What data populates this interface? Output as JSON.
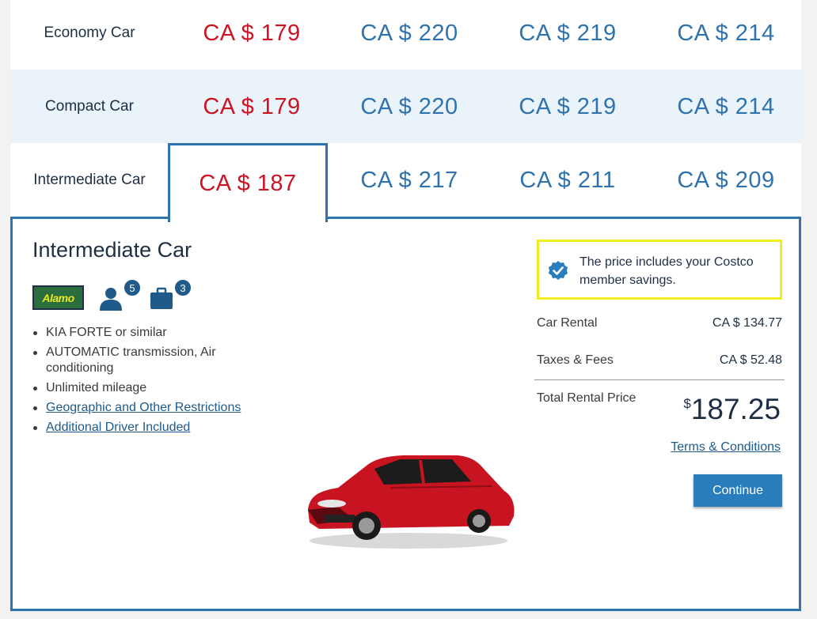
{
  "rate_table": {
    "rows": [
      {
        "category": "Economy Car",
        "prices": [
          "CA $ 179",
          "CA $ 220",
          "CA $ 219",
          "CA $ 214"
        ]
      },
      {
        "category": "Compact Car",
        "prices": [
          "CA $ 179",
          "CA $ 220",
          "CA $ 219",
          "CA $ 214"
        ]
      },
      {
        "category": "Intermediate Car",
        "prices": [
          "CA $ 187",
          "CA $ 217",
          "CA $ 211",
          "CA $ 209"
        ]
      }
    ],
    "selected_row": 2,
    "selected_col": 0
  },
  "detail": {
    "title": "Intermediate Car",
    "vendor_logo_text": "Alamo",
    "passengers": "5",
    "bags": "3",
    "specs": [
      "KIA FORTE or similar",
      "AUTOMATIC transmission, Air conditioning",
      "Unlimited mileage"
    ],
    "links": [
      "Geographic and Other Restrictions",
      "Additional Driver Included"
    ]
  },
  "pricing": {
    "savings_message": "The price includes your Costco member savings.",
    "car_rental_label": "Car Rental",
    "car_rental_value": "CA $ 134.77",
    "taxes_label": "Taxes & Fees",
    "taxes_value": "CA $ 52.48",
    "total_label": "Total Rental Price",
    "total_currency": "$",
    "total_value": "187.25",
    "terms_link": "Terms & Conditions",
    "continue_label": "Continue"
  },
  "colors": {
    "best_price": "#cc1424",
    "price": "#2f73ae",
    "selection_border": "#2f73ae",
    "savings_highlight": "#f0ee1e",
    "button": "#2a7dbd"
  },
  "icons": [
    "person-icon",
    "suitcase-icon",
    "checkmark-badge-icon"
  ]
}
